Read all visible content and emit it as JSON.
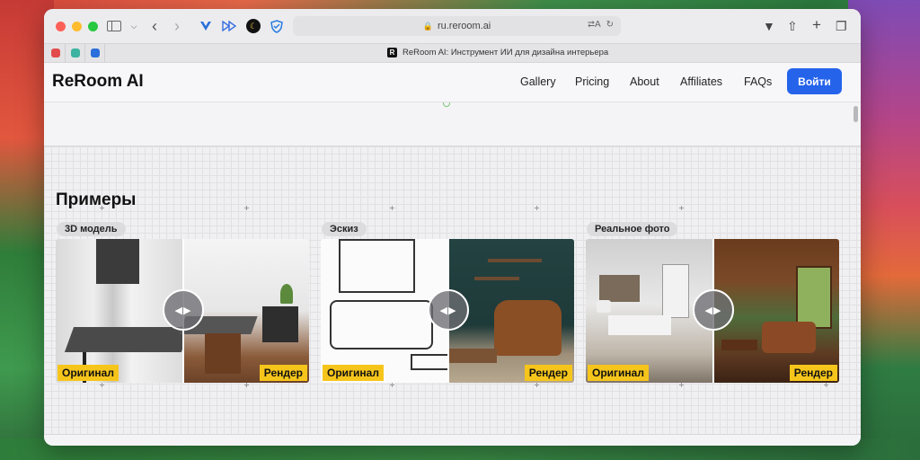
{
  "browser": {
    "url": "ru.reroom.ai",
    "active_tab_title": "ReRoom AI: Инструмент ИИ для дизайна интерьера",
    "tab_favicon_letter": "R",
    "translate_indicator": "⮂A",
    "reload_icon": "↻"
  },
  "site": {
    "logo": "ReRoom AI",
    "nav": [
      "Gallery",
      "Pricing",
      "About",
      "Affiliates",
      "FAQs"
    ],
    "login_label": "Войти"
  },
  "examples": {
    "title": "Примеры",
    "cards": [
      {
        "tag": "3D модель",
        "original_label": "Оригинал",
        "render_label": "Рендер"
      },
      {
        "tag": "Эскиз",
        "original_label": "Оригинал",
        "render_label": "Рендер"
      },
      {
        "tag": "Реальное фото",
        "original_label": "Оригинал",
        "render_label": "Рендер"
      }
    ]
  },
  "colors": {
    "accent_button": "#2563eb",
    "label_yellow": "#f6c51b"
  },
  "icons": [
    "sidebar-icon",
    "back-icon",
    "forward-icon",
    "download-icon",
    "share-icon",
    "new-tab-icon",
    "tabs-icon",
    "lock-icon",
    "slider-arrows-icon"
  ]
}
